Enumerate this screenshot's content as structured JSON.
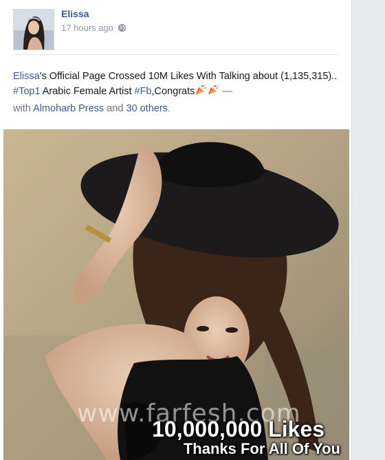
{
  "post": {
    "author": "Elissa",
    "timestamp": "17 hours ago",
    "privacy_icon": "globe-icon",
    "text": {
      "mention": "Elissa",
      "part1": "'s Official Page Crossed 10M Likes With Talking about (1,135,315).. ",
      "hashtag1": "#Top1",
      "part2": " Arabic Female Artist ",
      "hashtag2": "#Fb",
      "part3": ",Congrats",
      "dash": " —",
      "with_label": "with",
      "tagged": "Almoharb Press",
      "and_label": "and",
      "others": "30 others",
      "period": "."
    }
  },
  "photo": {
    "watermark": "www.farfesh.com",
    "caption_line1": "10,000,000 Likes",
    "caption_line2": "Thanks For All Of You"
  },
  "colors": {
    "link": "#3b5998",
    "meta": "#9197a3",
    "gutter": "#e9eaed"
  }
}
